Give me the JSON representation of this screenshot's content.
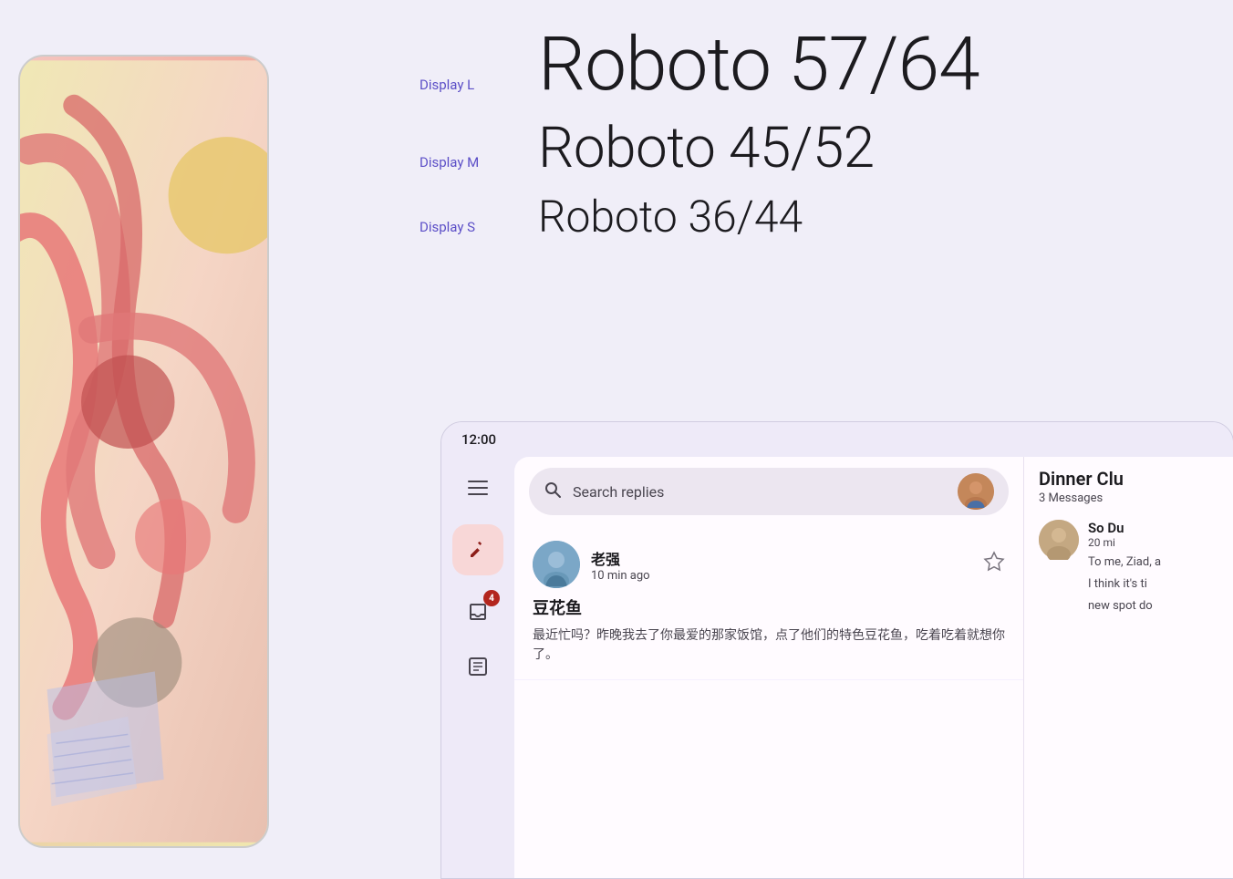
{
  "background_color": "#f0eef8",
  "phone": {
    "frame_bg": "#f5c5c0"
  },
  "typography": {
    "display_l": {
      "label": "Display L",
      "sample": "Roboto 57/64"
    },
    "display_m": {
      "label": "Display M",
      "sample": "Roboto 45/52"
    },
    "display_s": {
      "label": "Display S",
      "sample": "Roboto 36/44"
    }
  },
  "app": {
    "status_time": "12:00",
    "search_placeholder": "Search replies",
    "message": {
      "sender": "老强",
      "time_ago": "10 min ago",
      "title": "豆花鱼",
      "preview": "最近忙吗？昨晚我去了你最爱的那家饭馆，点了他们的特色豆花鱼，吃着吃着就想你了。"
    },
    "right_panel": {
      "title": "Dinner Clu",
      "message_count": "3 Messages",
      "contact": {
        "name": "So Du",
        "time": "20 mi",
        "preview_line1": "To me, Ziad, a",
        "preview_line2": "I think it's ti",
        "preview_line3": "new spot do"
      }
    },
    "sidebar": {
      "badge_count": "4"
    }
  },
  "icons": {
    "hamburger": "≡",
    "search": "🔍",
    "edit": "✏",
    "inbox": "📥",
    "notes": "📋",
    "star": "☆"
  }
}
